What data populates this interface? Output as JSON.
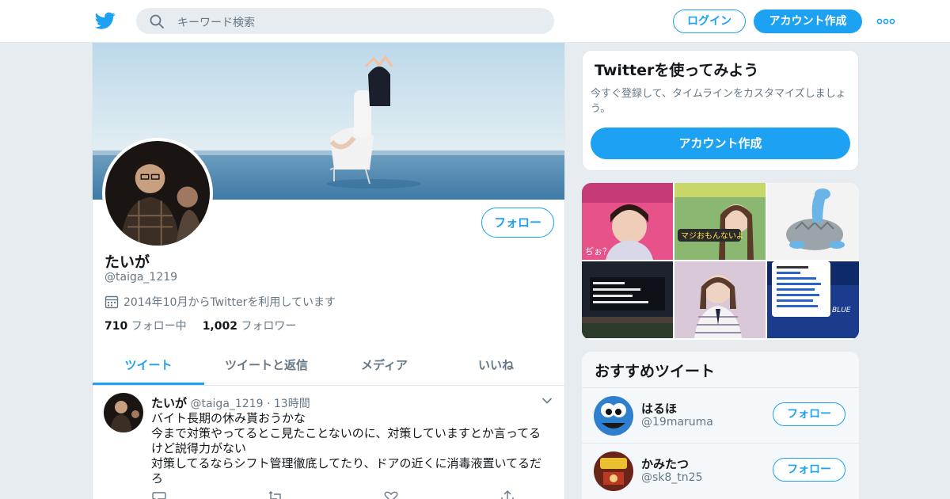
{
  "header": {
    "search_placeholder": "キーワード検索",
    "login_label": "ログイン",
    "signup_label": "アカウント作成"
  },
  "profile": {
    "name": "たいが",
    "handle": "@taiga_1219",
    "joined": "2014年10月からTwitterを利用しています",
    "following_count": "710",
    "following_label": "フォロー中",
    "followers_count": "1,002",
    "followers_label": "フォロワー",
    "follow_button": "フォロー"
  },
  "tabs": [
    {
      "label": "ツイート",
      "active": true
    },
    {
      "label": "ツイートと返信",
      "active": false
    },
    {
      "label": "メディア",
      "active": false
    },
    {
      "label": "いいね",
      "active": false
    }
  ],
  "tweet": {
    "name": "たいが",
    "handle": "@taiga_1219",
    "separator": "·",
    "time": "13時間",
    "lines": [
      "バイト長期の休み貰おうかな",
      "今まで対策やってるとこ見たことないのに、対策していますとか言ってるけど説得力がない",
      "対策してるならシフト管理徹底してたり、ドアの近くに消毒液置いてるだろ"
    ]
  },
  "signup_card": {
    "title": "Twitterを使ってみよう",
    "description": "今すぐ登録して、タイムラインをカスタマイズしましょう。",
    "button": "アカウント作成"
  },
  "recommendations": {
    "title": "おすすめツイート",
    "items": [
      {
        "name": "はるほ",
        "handle": "@19maruma",
        "button": "フォロー"
      },
      {
        "name": "かみたつ",
        "handle": "@sk8_tn25",
        "button": "フォロー"
      }
    ]
  },
  "colors": {
    "accent": "#1da1f2",
    "background": "#e6ecf0",
    "secondary_text": "#657786"
  }
}
